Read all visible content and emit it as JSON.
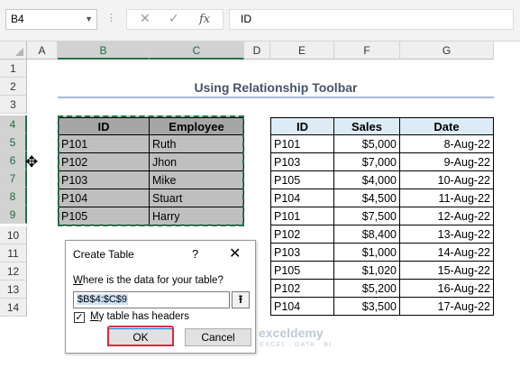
{
  "formula_bar": {
    "name_box": "B4",
    "cancel_glyph": "✕",
    "enter_glyph": "✓",
    "fx_label": "fx",
    "formula": "ID"
  },
  "columns": [
    "A",
    "B",
    "C",
    "D",
    "E",
    "F",
    "G"
  ],
  "rows": [
    "1",
    "2",
    "3",
    "4",
    "5",
    "6",
    "7",
    "8",
    "9",
    "10",
    "11",
    "12",
    "13",
    "14"
  ],
  "title": "Using Relationship Toolbar",
  "employee_table": {
    "headers": [
      "ID",
      "Employee"
    ],
    "rows": [
      [
        "P101",
        "Ruth"
      ],
      [
        "P102",
        "Jhon"
      ],
      [
        "P103",
        "Mike"
      ],
      [
        "P104",
        "Stuart"
      ],
      [
        "P105",
        "Harry"
      ]
    ]
  },
  "sales_table": {
    "headers": [
      "ID",
      "Sales",
      "Date"
    ],
    "rows": [
      [
        "P101",
        "$5,000",
        "8-Aug-22"
      ],
      [
        "P103",
        "$7,000",
        "9-Aug-22"
      ],
      [
        "P105",
        "$4,000",
        "10-Aug-22"
      ],
      [
        "P104",
        "$4,500",
        "11-Aug-22"
      ],
      [
        "P101",
        "$7,500",
        "12-Aug-22"
      ],
      [
        "P102",
        "$8,400",
        "13-Aug-22"
      ],
      [
        "P103",
        "$1,000",
        "14-Aug-22"
      ],
      [
        "P105",
        "$1,020",
        "15-Aug-22"
      ],
      [
        "P102",
        "$5,200",
        "16-Aug-22"
      ],
      [
        "P104",
        "$3,500",
        "17-Aug-22"
      ]
    ]
  },
  "dialog": {
    "title": "Create Table",
    "help": "?",
    "close": "✕",
    "prompt_prefix": "W",
    "prompt_rest": "here is the data for your table?",
    "range": "$B$4:$C$9",
    "collapse_glyph": "⭱",
    "checkbox_checked": true,
    "checkbox_mark": "✓",
    "checkbox_prefix": "M",
    "checkbox_rest": "y table has headers",
    "ok": "OK",
    "cancel": "Cancel"
  },
  "watermark": {
    "name": "exceldemy",
    "sub": "EXCEL · DATA · BI"
  },
  "icons": {
    "cursor": "cell-select-cursor-icon",
    "fx": "function-icon",
    "collapse": "collapse-dialog-icon"
  },
  "colors": {
    "header_fill": "#ddebf7",
    "selected_fill": "#bfbfbf",
    "accent": "#217346",
    "title_text": "#44546a",
    "highlight": "#e0293a"
  }
}
